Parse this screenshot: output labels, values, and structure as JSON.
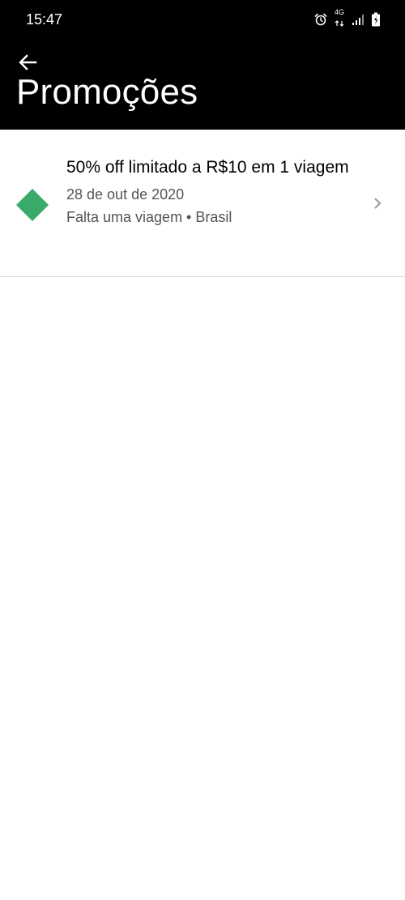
{
  "status_bar": {
    "time": "15:47",
    "network_label_top": "4G",
    "icons": [
      "alarm-icon",
      "network-4g-icon",
      "signal-icon",
      "battery-icon"
    ]
  },
  "header": {
    "title": "Promoções",
    "back_icon": "arrow-left-icon"
  },
  "promotions": [
    {
      "title": "50% off limitado a R$10 em 1 viagem",
      "date": "28 de out de 2020",
      "meta": "Falta uma viagem • Brasil",
      "icon": "tag-icon",
      "icon_color": "#3aaa6a"
    }
  ],
  "colors": {
    "header_background": "#000000",
    "header_text": "#ffffff",
    "tag_green": "#3aaa6a",
    "secondary_text": "#545454",
    "chevron": "#a6a6a6",
    "divider": "#dcdcdc"
  }
}
